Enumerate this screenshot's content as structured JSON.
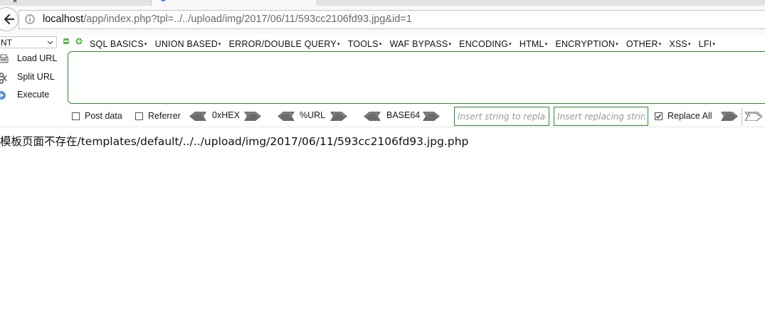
{
  "browser": {
    "url_host": "localhost",
    "url_rest": "/app/index.php?tpl=../../upload/img/2017/06/11/593cc2106fd93.jpg&id=1"
  },
  "hackbar": {
    "version_select": "NT",
    "menus": [
      "SQL BASICS",
      "UNION BASED",
      "ERROR/DOUBLE QUERY",
      "TOOLS",
      "WAF BYPASS",
      "ENCODING",
      "HTML",
      "ENCRYPTION",
      "OTHER",
      "XSS",
      "LFI"
    ],
    "actions": {
      "load_url": "Load URL",
      "split_url": "Split URL",
      "execute": "Execute"
    },
    "textarea_value": "",
    "options": {
      "post_data": "Post data",
      "referrer": "Referrer",
      "hex": "0xHEX",
      "url": "%URL",
      "base64": "BASE64",
      "replace_placeholder": "Insert string to replace",
      "replacing_placeholder": "Insert replacing string",
      "replace_all": "Replace All"
    },
    "checked": {
      "post_data": false,
      "referrer": false,
      "replace_all": true
    }
  },
  "page": {
    "message": "模板页面不存在/templates/default/../../upload/img/2017/06/11/593cc2106fd93.jpg.php"
  },
  "colors": {
    "accent_green": "#2d8a2d"
  },
  "icons": [
    "back-arrow-icon",
    "info-icon",
    "chevron-down-icon",
    "minus-icon",
    "plus-icon",
    "load-url-icon",
    "split-url-icon",
    "execute-icon",
    "arrow-left-icon",
    "arrow-right-icon"
  ]
}
